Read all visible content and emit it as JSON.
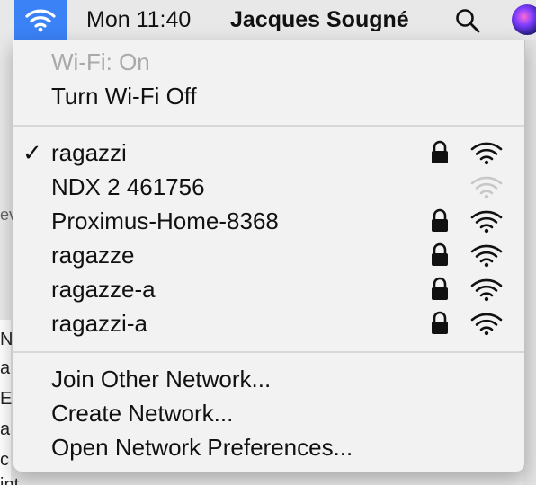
{
  "menubar": {
    "clock": "Mon 11:40",
    "username": "Jacques Sougné",
    "wifi_icon": "wifi-icon",
    "search_icon": "search-icon",
    "siri_icon": "siri-icon",
    "accent": "#3b82f6"
  },
  "wifi_menu": {
    "status": "Wi-Fi: On",
    "toggle": "Turn Wi-Fi Off",
    "networks": [
      {
        "name": "ragazzi",
        "connected": true,
        "checkmark": "✓",
        "locked": true,
        "signal": "strong"
      },
      {
        "name": "NDX 2 461756",
        "connected": false,
        "checkmark": "",
        "locked": false,
        "signal": "weak"
      },
      {
        "name": "Proximus-Home-8368",
        "connected": false,
        "checkmark": "",
        "locked": true,
        "signal": "strong"
      },
      {
        "name": "ragazze",
        "connected": false,
        "checkmark": "",
        "locked": true,
        "signal": "strong"
      },
      {
        "name": "ragazze-a",
        "connected": false,
        "checkmark": "",
        "locked": true,
        "signal": "strong"
      },
      {
        "name": "ragazzi-a",
        "connected": false,
        "checkmark": "",
        "locked": true,
        "signal": "strong"
      }
    ],
    "actions": {
      "join_other": "Join Other Network...",
      "create": "Create Network...",
      "preferences": "Open Network Preferences..."
    }
  },
  "background": {
    "fragments": [
      "ev",
      "N",
      "a",
      "E",
      "a",
      "c",
      "int"
    ]
  }
}
